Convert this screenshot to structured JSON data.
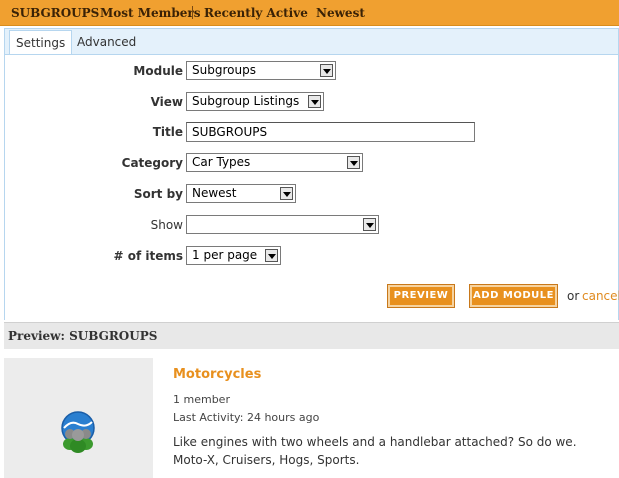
{
  "topnav": {
    "items": [
      "SUBGROUPS",
      "Most Members",
      "Recently Active",
      "Newest"
    ]
  },
  "tabs": [
    "Settings",
    "Advanced"
  ],
  "form": {
    "module": {
      "label": "Module",
      "value": "Subgroups"
    },
    "view": {
      "label": "View",
      "value": "Subgroup Listings"
    },
    "title": {
      "label": "Title",
      "value": "SUBGROUPS"
    },
    "category": {
      "label": "Category",
      "value": "Car Types"
    },
    "sort": {
      "label": "Sort by",
      "value": "Newest"
    },
    "show": {
      "label": "Show",
      "value": ""
    },
    "items": {
      "label": "# of items",
      "value": "1 per page"
    }
  },
  "actions": {
    "preview": "PREVIEW",
    "add_module": "ADD MODULE",
    "or": "or",
    "cancel": "cancel"
  },
  "preview": {
    "heading": "Preview: SUBGROUPS",
    "group": {
      "icon": "group-people-icon",
      "name": "Motorcycles",
      "members": "1 member",
      "activity": "Last Activity: 24 hours ago",
      "description": "Like engines with two wheels and a handlebar attached? So do we. Moto-X, Cruisers, Hogs, Sports."
    }
  },
  "colors": {
    "accent": "#f0a030",
    "panel": "#e4f1fb",
    "link": "#e8901e"
  }
}
